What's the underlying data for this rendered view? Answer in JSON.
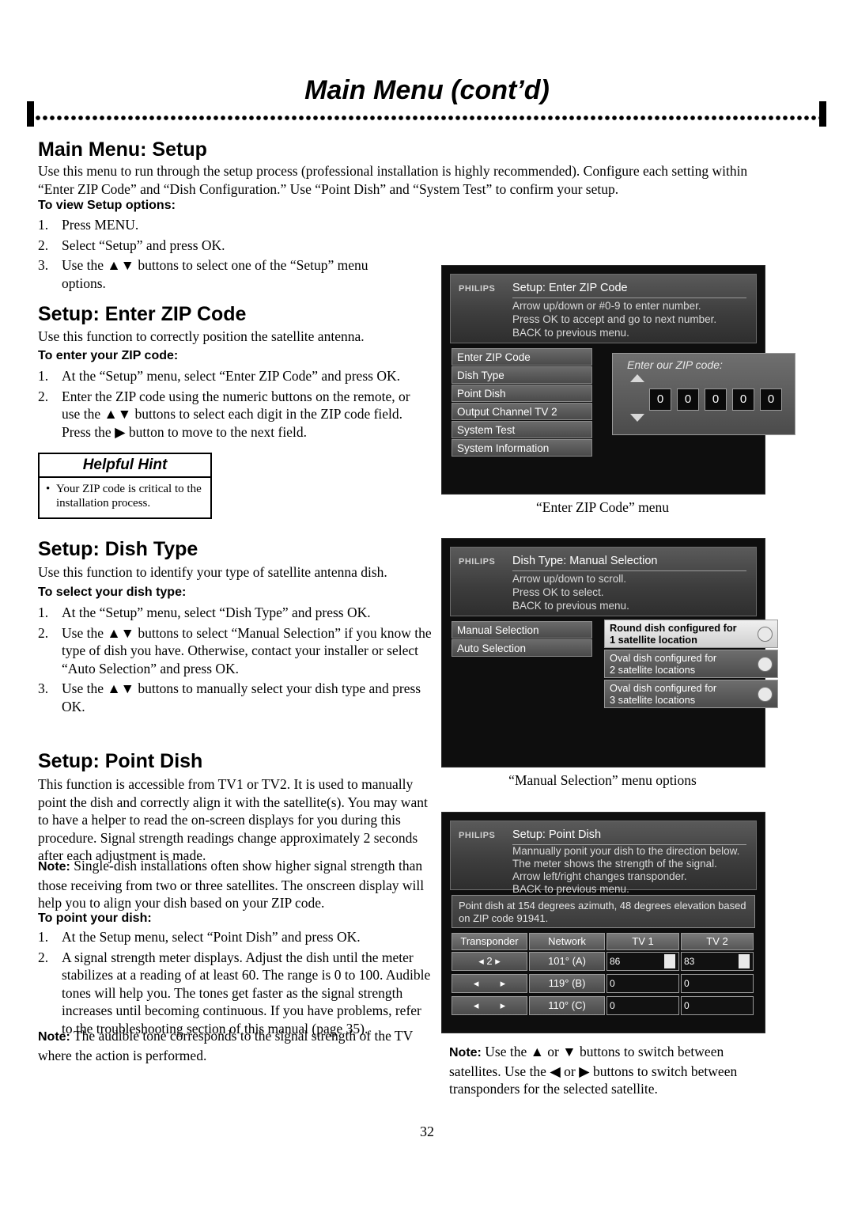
{
  "header": {
    "title": "Main Menu (cont’d)"
  },
  "sections": {
    "setup": {
      "heading": "Main Menu: Setup",
      "intro": "Use this menu to run through the setup process (professional installation is highly recommended). Configure each setting within “Enter ZIP Code” and “Dish Configuration.” Use “Point Dish” and “System Test” to confirm your setup.",
      "lead": "To view Setup options:",
      "steps": [
        "Press MENU.",
        "Select “Setup” and press OK.",
        "Use the ▲▼ buttons to select one of the “Setup” menu options."
      ]
    },
    "zip": {
      "heading": "Setup: Enter ZIP Code",
      "intro": "Use this function to correctly position the satellite antenna.",
      "lead": "To enter your ZIP code:",
      "steps": [
        "At the “Setup” menu, select “Enter ZIP Code” and press OK.",
        "Enter the ZIP code using the numeric buttons on the remote, or use the ▲▼ buttons to select each digit in the ZIP code field. Press the ▶ button to move to the next field."
      ]
    },
    "hint": {
      "title": "Helpful Hint",
      "bullet": "•",
      "text": "Your ZIP code is critical to the installation process."
    },
    "dish": {
      "heading": "Setup: Dish Type",
      "intro": "Use this function to identify your type of satellite antenna dish.",
      "lead": "To select your dish type:",
      "steps": [
        "At the “Setup” menu, select “Dish Type” and press OK.",
        "Use the ▲▼ buttons to select “Manual Selection” if you know the type of dish you have. Otherwise, contact your installer or select “Auto Selection” and press OK.",
        "Use the ▲▼ buttons to manually select your dish type and press OK."
      ]
    },
    "point": {
      "heading": "Setup: Point Dish",
      "intro": "This function is accessible from TV1 or TV2. It is used to manually point the dish and correctly align it with the satellite(s). You may want to have a helper to read the on-screen displays for you during this procedure. Signal strength readings change approximately 2 seconds after each adjustment is made.",
      "note1_label": "Note:",
      "note1": " Single-dish installations often show higher signal strength than those receiving from two or three satellites. The onscreen display will help you to align your dish based on your ZIP code.",
      "lead": "To point your dish:",
      "steps": [
        "At the Setup menu, select “Point Dish” and press OK.",
        "A signal strength meter displays. Adjust the dish until the meter stabilizes at a reading of at least 60. The range is 0 to 100. Audible tones will help you. The tones get faster as the signal strength increases until becoming continuous. If you have problems, refer to the troubleshooting section of this manual (page 35)."
      ],
      "note2_label": "Note:",
      "note2": " The audible tone corresponds to the signal strength of the TV where the action is performed."
    }
  },
  "screens": {
    "zip": {
      "brand": "PHILIPS",
      "title": "Setup: Enter ZIP Code",
      "lines": [
        "Arrow up/down or #0-9 to enter number.",
        "Press OK to accept and go to next number.",
        "BACK to previous menu."
      ],
      "menu": [
        "Enter ZIP Code",
        "Dish Type",
        "Point Dish",
        "Output Channel TV 2",
        "System Test",
        "System Information"
      ],
      "panel_label": "Enter our ZIP code:",
      "digits": [
        "0",
        "0",
        "0",
        "0",
        "0"
      ],
      "caption": "“Enter ZIP Code” menu"
    },
    "dish": {
      "brand": "PHILIPS",
      "title": "Dish Type: Manual Selection",
      "lines": [
        "Arrow up/down to scroll.",
        "Press OK to select.",
        "BACK to previous menu."
      ],
      "menu": [
        "Manual Selection",
        "Auto Selection"
      ],
      "options": [
        {
          "line1": "Round dish configured for",
          "line2": "1 satellite location",
          "selected": true
        },
        {
          "line1": "Oval dish configured for",
          "line2": "2 satellite locations",
          "selected": false
        },
        {
          "line1": "Oval dish configured for",
          "line2": "3 satellite locations",
          "selected": false
        }
      ],
      "caption": "“Manual Selection” menu options"
    },
    "point": {
      "brand": "PHILIPS",
      "title": "Setup: Point Dish",
      "lines": [
        "Mannually ponit your dish to the direction below.",
        "The meter shows the strength of the signal.",
        "Arrow left/right changes transponder.",
        "BACK to previous menu."
      ],
      "note": "Point dish at 154 degrees azimuth, 48 degrees elevation based on ZIP code 91941.",
      "headers": [
        "Transponder",
        "Network",
        "TV 1",
        "TV 2"
      ],
      "transponder_value": "2",
      "rows": [
        {
          "sat": "101° (A)",
          "tv1": "86",
          "tv2": "83"
        },
        {
          "sat": "119° (B)",
          "tv1": "0",
          "tv2": "0"
        },
        {
          "sat": "110° (C)",
          "tv1": "0",
          "tv2": "0"
        }
      ]
    }
  },
  "footer": {
    "note_label": "Note:",
    "note_text": " Use the ▲ or ▼ buttons to switch between satellites. Use the ◀ or ▶ buttons to switch between transponders for the selected satellite.",
    "page_number": "32"
  }
}
